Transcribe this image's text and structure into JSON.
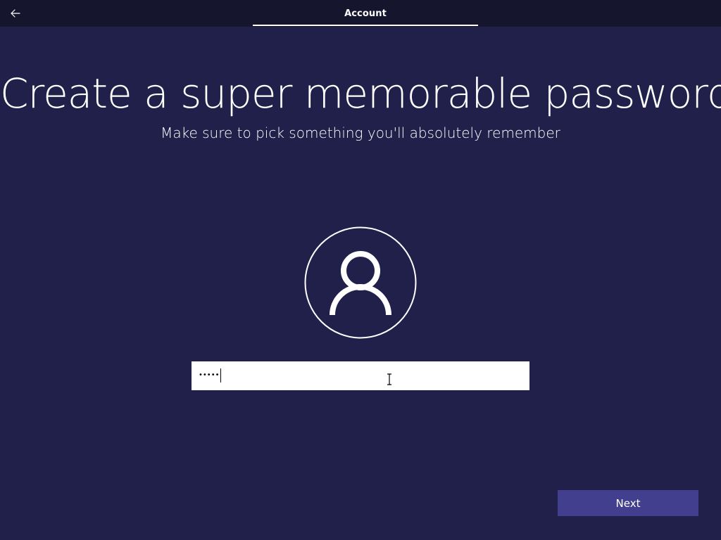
{
  "header": {
    "back_icon": "arrow-left-icon",
    "tab_label": "Account"
  },
  "main": {
    "title": "Create a super memorable password",
    "subtitle": "Make sure to pick something you'll absolutely remember",
    "avatar_icon": "user-icon",
    "password": {
      "masked_value": "•••••"
    }
  },
  "footer": {
    "next_label": "Next"
  },
  "colors": {
    "background": "#21204a",
    "topbar": "#16152e",
    "accent_button": "#433f8f",
    "text": "#ffffff"
  }
}
